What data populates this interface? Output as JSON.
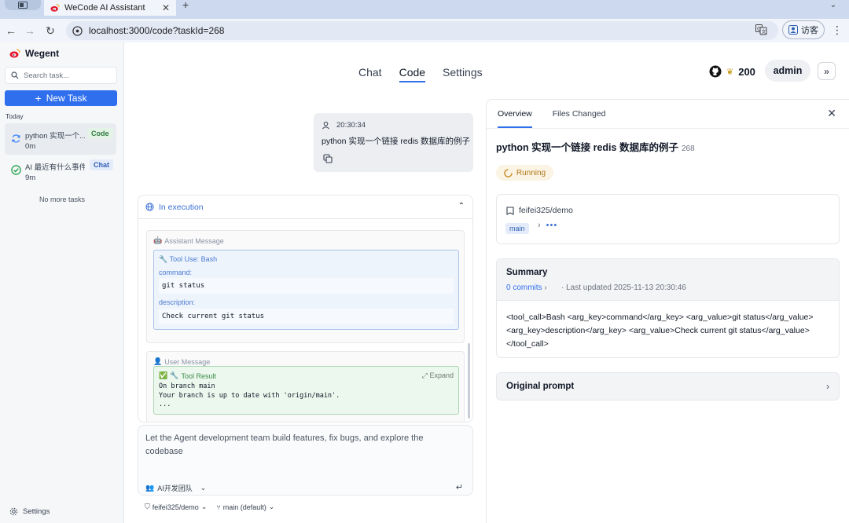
{
  "browser": {
    "tab_title": "WeCode AI Assistant",
    "url": "localhost:3000/code?taskId=268",
    "guest_label": "访客"
  },
  "sidebar": {
    "brand": "Wegent",
    "search_placeholder": "Search task...",
    "new_task_label": "New Task",
    "section_today": "Today",
    "tasks": [
      {
        "title": "python 实现一个...",
        "duration": "0m",
        "badge": "Code",
        "status": "running"
      },
      {
        "title": "AI 最近有什么事件",
        "duration": "9m",
        "badge": "Chat",
        "status": "done"
      }
    ],
    "no_more": "No more tasks",
    "settings_label": "Settings"
  },
  "header": {
    "tabs": [
      "Chat",
      "Code",
      "Settings"
    ],
    "active_tab": "Code",
    "github_count": "200",
    "user": "admin"
  },
  "conversation": {
    "user_message": {
      "time": "20:30:34",
      "text": "python 实现一个链接 redis 数据库的例子"
    },
    "execution": {
      "header": "In execution",
      "assistant_title": "Assistant Message",
      "tool_use_title": "Tool Use: Bash",
      "command_label": "command:",
      "command_value": "git status",
      "description_label": "description:",
      "description_value": "Check current git status",
      "user_title": "User Message",
      "tool_result_title": "Tool Result",
      "expand_label": "Expand",
      "tool_result_lines": [
        "On branch main",
        "Your branch is up to date with 'origin/main'.",
        "..."
      ]
    },
    "composer": {
      "placeholder": "Let the Agent development team build features, fix bugs, and explore the codebase",
      "team": "AI开发团队"
    },
    "repo": "feifei325/demo",
    "branch": "main (default)"
  },
  "panel": {
    "tabs": [
      "Overview",
      "Files Changed"
    ],
    "title": "python 实现一个链接 redis 数据库的例子",
    "task_id": "268",
    "status": "Running",
    "repo": "feifei325/demo",
    "branch": "main",
    "summary": {
      "title": "Summary",
      "commits": "0 commits",
      "updated": "·  Last updated 2025-11-13 20:30:46",
      "body": "<tool_call>Bash <arg_key>command</arg_key> <arg_value>git status</arg_value> <arg_key>description</arg_key> <arg_value>Check current git status</arg_value> </tool_call>"
    },
    "original_prompt": "Original prompt"
  },
  "colors": {
    "primary": "#2f6fed",
    "running": "#b07a1a",
    "tool_use_bg": "#eef4fc",
    "tool_result_bg": "#ecf7ed"
  }
}
